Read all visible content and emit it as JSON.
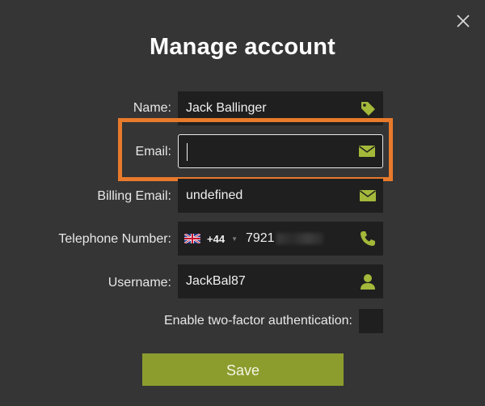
{
  "dialog": {
    "title": "Manage account",
    "close_icon": "close-icon"
  },
  "fields": {
    "name": {
      "label": "Name:",
      "value": "Jack Ballinger",
      "icon": "tag-icon"
    },
    "email": {
      "label": "Email:",
      "value": "",
      "icon": "envelope-icon"
    },
    "billing_email": {
      "label": "Billing Email:",
      "value": "undefined",
      "icon": "envelope-icon"
    },
    "telephone": {
      "label": "Telephone Number:",
      "country_flag": "uk-flag-icon",
      "dial_code": "+44",
      "number_visible": "7921",
      "icon": "phone-icon"
    },
    "username": {
      "label": "Username:",
      "value": "JackBal87",
      "icon": "user-icon"
    }
  },
  "two_factor": {
    "label": "Enable two-factor authentication:",
    "checked": false
  },
  "save_label": "Save",
  "colors": {
    "accent": "#8c9d2e",
    "icon": "#a4b83a",
    "highlight": "#e87a2b",
    "background": "#353535",
    "field_bg": "#1f1f1f"
  }
}
